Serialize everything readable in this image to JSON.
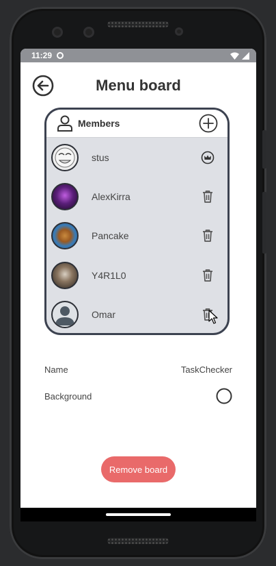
{
  "status_bar": {
    "time": "11:29"
  },
  "header": {
    "title": "Menu board"
  },
  "members": {
    "title": "Members",
    "list": [
      {
        "name": "stus",
        "action": "crown-icon",
        "avatar_color": "#eeeeee"
      },
      {
        "name": "AlexKirra",
        "action": "trash-icon",
        "avatar_color": "#5b1f7a"
      },
      {
        "name": "Pancake",
        "action": "trash-icon",
        "avatar_color": "#c98a3e"
      },
      {
        "name": "Y4R1L0",
        "action": "trash-icon",
        "avatar_color": "#6b5a4a"
      },
      {
        "name": "Omar",
        "action": "trash-icon",
        "avatar_color": "#4e5964"
      }
    ]
  },
  "settings": {
    "name_label": "Name",
    "name_value": "TaskChecker",
    "background_label": "Background"
  },
  "actions": {
    "remove_label": "Remove board"
  },
  "colors": {
    "accent_danger": "#e96a6a",
    "card_bg": "#dee0e5",
    "card_border": "#3c4250"
  }
}
